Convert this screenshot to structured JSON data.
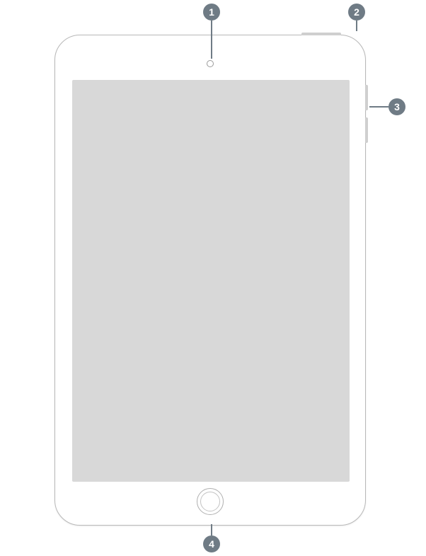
{
  "device_name": "iPad",
  "callouts": {
    "c1": {
      "number": "1",
      "target": "front-camera"
    },
    "c2": {
      "number": "2",
      "target": "top-button"
    },
    "c3": {
      "number": "3",
      "target": "volume-buttons"
    },
    "c4": {
      "number": "4",
      "target": "home-button"
    }
  },
  "colors": {
    "callout_bg": "#6f7b85",
    "callout_text": "#ffffff",
    "screen": "#d8d8d8",
    "device_border": "#b8b8b8"
  }
}
